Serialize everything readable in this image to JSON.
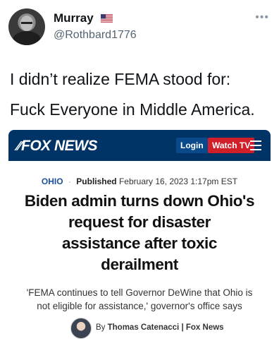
{
  "tweet": {
    "display_name": "Murray",
    "handle": "@Rothbard1776",
    "text_line1": "I didn’t realize FEMA stood for:",
    "text_line2": "Fuck Everyone in Middle America.",
    "more_icon": "more-horizontal-icon"
  },
  "article": {
    "logo": "FOX NEWS",
    "login_label": "Login",
    "watch_label": "Watch TV",
    "section": "OHIO",
    "published_label": "Published",
    "published_date": "February 16, 2023 1:17pm EST",
    "headline_lines": [
      "Biden admin turns down Ohio's",
      "request for disaster",
      "assistance after toxic",
      "derailment"
    ],
    "subhead_lines": [
      "'FEMA continues to tell Governor DeWine that Ohio is",
      "not eligible for assistance,' governor's office says"
    ],
    "byline_prefix": "By",
    "author": "Thomas Catenacci",
    "outlet": "Fox News",
    "colors": {
      "bar": "#003366",
      "watch_button": "#d11f29",
      "section": "#1c4f9c"
    }
  }
}
